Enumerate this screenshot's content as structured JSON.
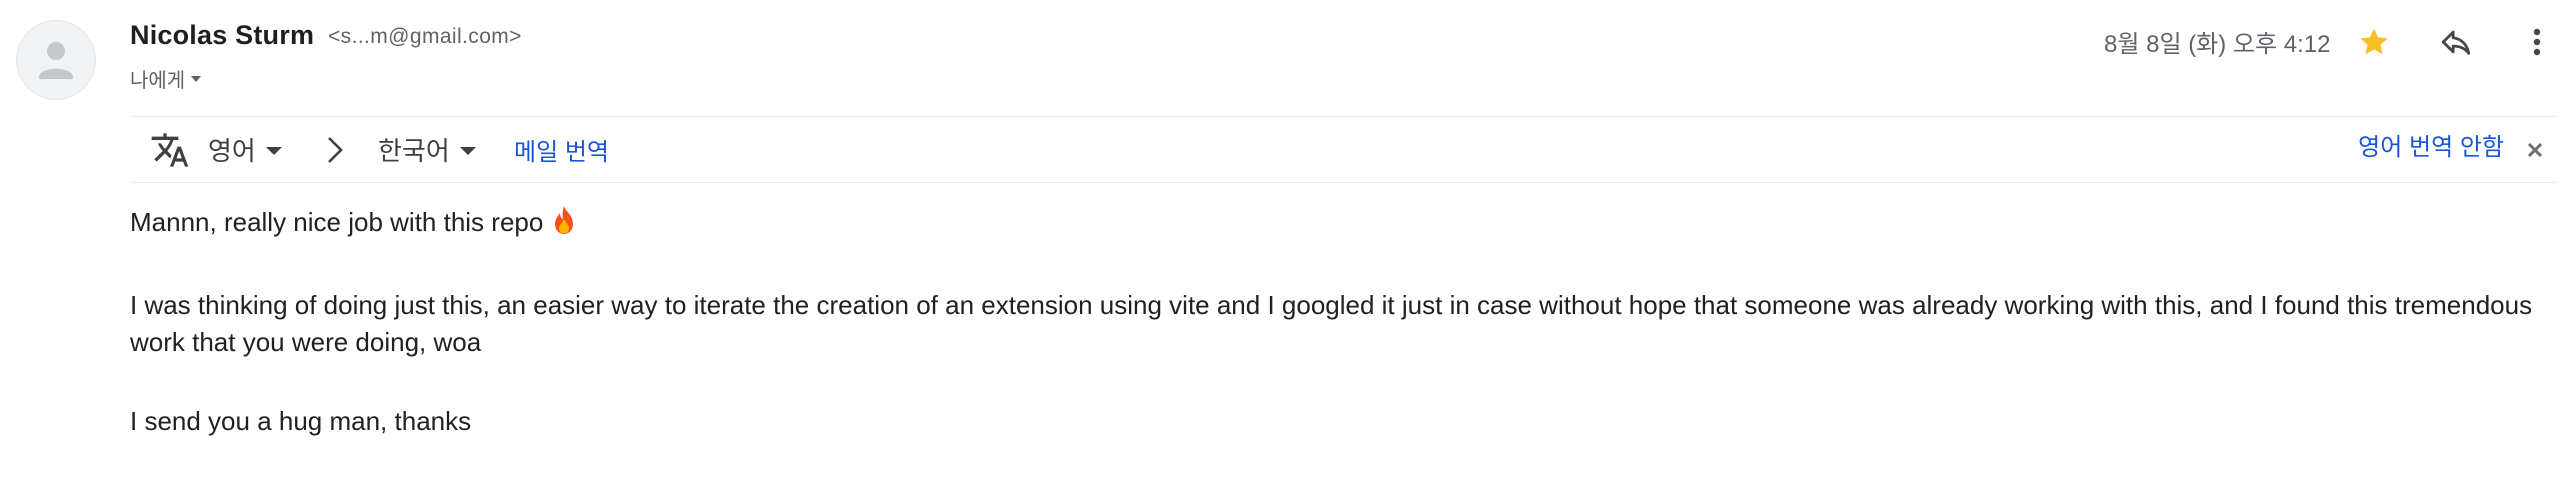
{
  "sender": {
    "name": "Nicolas Sturm",
    "email": "<s...m@gmail.com>",
    "recipient": "나에게"
  },
  "header": {
    "date": "8월 8일 (화) 오후 4:12",
    "icons": [
      "star-icon",
      "reply-icon",
      "more-vert-icon"
    ],
    "star_color": "#F6BF26"
  },
  "translate_bar": {
    "icon": "translate-icon",
    "source_language": "영어",
    "target_language": "한국어",
    "translate_link": "메일 번역",
    "dont_translate": "영어 번역 안함",
    "link_color": "#1A55D6"
  },
  "message": {
    "paragraphs": [
      "Mannn, really nice job with this repo",
      "I was thinking of doing just this, an easier way to iterate the creation of an extension using vite and I googled it just in case without hope that someone was already working with this, and I found this tremendous work that you were doing, woa",
      "I send you a hug man, thanks"
    ],
    "emoji": "fire-icon"
  }
}
